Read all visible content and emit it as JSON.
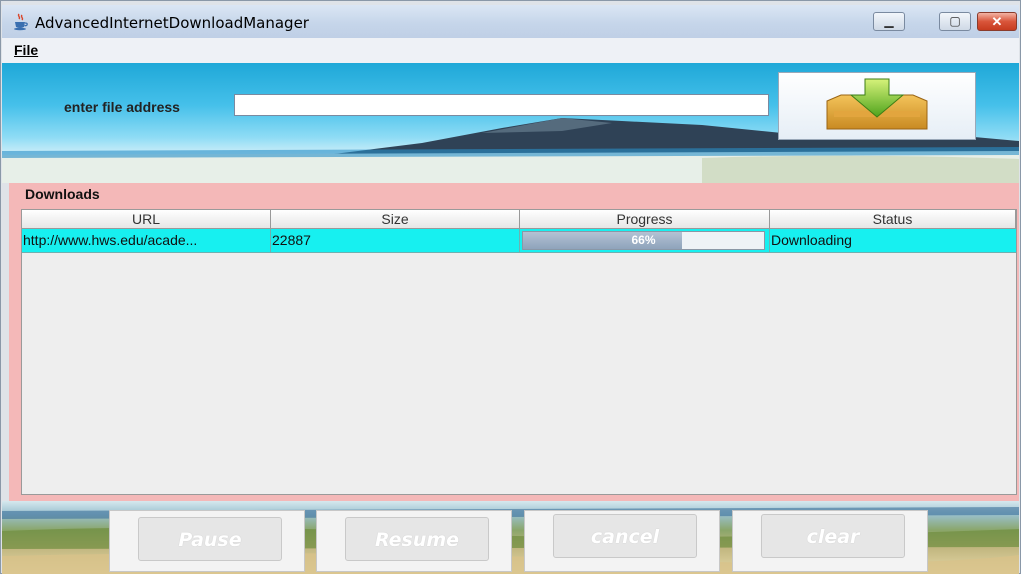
{
  "window": {
    "title": "AdvancedInternetDownloadManager",
    "controls": [
      "minimize",
      "maximize",
      "close"
    ]
  },
  "menu": {
    "items": [
      "File"
    ]
  },
  "address": {
    "label": "enter file address",
    "value": "",
    "placeholder": ""
  },
  "downloads": {
    "title": "Downloads",
    "columns": [
      "URL",
      "Size",
      "Progress",
      "Status"
    ],
    "rows": [
      {
        "url": "http://www.hws.edu/acade...",
        "size": "22887",
        "progress": 66,
        "progress_label": "66%",
        "status": "Downloading"
      }
    ]
  },
  "buttons": {
    "pause": "Pause",
    "resume": "Resume",
    "cancel": "cancel",
    "clear": "clear"
  },
  "colors": {
    "selected_row": "#17f0f0",
    "panel_bg": "#f4b8b8",
    "progress_fill": "#9fb1c6"
  },
  "icons": {
    "app": "java-cup-icon",
    "download": "download-tray-icon"
  }
}
